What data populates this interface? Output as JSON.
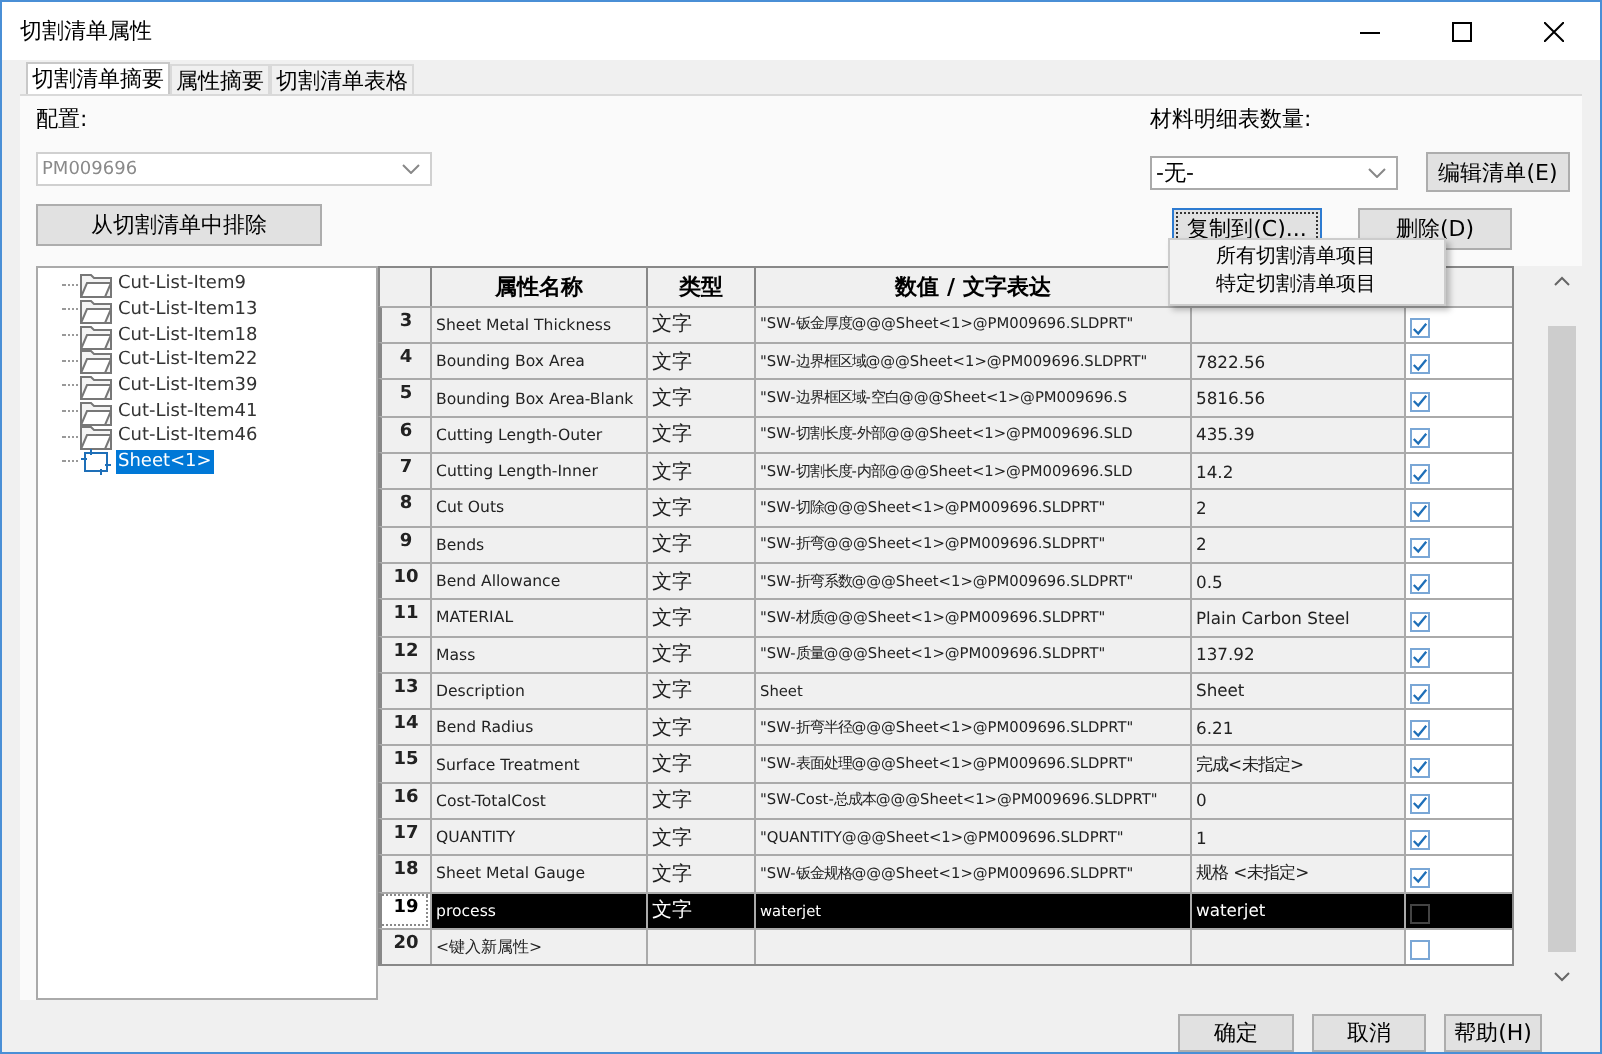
{
  "window": {
    "title": "切割清单属性"
  },
  "tabs": [
    {
      "label": "切割清单摘要",
      "selected": true
    },
    {
      "label": "属性摘要",
      "selected": false
    },
    {
      "label": "切割清单表格",
      "selected": false
    }
  ],
  "config": {
    "label": "配置:",
    "value": "PM009696",
    "disabled": true
  },
  "bom_quantity": {
    "label": "材料明细表数量:",
    "value": "-无-"
  },
  "buttons": {
    "edit_list": "编辑清单(E)",
    "exclude": "从切割清单中排除",
    "copy_to": "复制到(C)...",
    "delete": "删除(D)"
  },
  "copy_menu": [
    "所有切割清单项目",
    "特定切割清单项目"
  ],
  "tree": [
    {
      "label": "Cut-List-Item9",
      "kind": "folder",
      "selected": false
    },
    {
      "label": "Cut-List-Item13",
      "kind": "folder",
      "selected": false
    },
    {
      "label": "Cut-List-Item18",
      "kind": "folder",
      "selected": false
    },
    {
      "label": "Cut-List-Item22",
      "kind": "folder",
      "selected": false
    },
    {
      "label": "Cut-List-Item39",
      "kind": "folder",
      "selected": false
    },
    {
      "label": "Cut-List-Item41",
      "kind": "folder",
      "selected": false
    },
    {
      "label": "Cut-List-Item46",
      "kind": "folder",
      "selected": false
    },
    {
      "label": "Sheet<1>",
      "kind": "sheet",
      "selected": true
    }
  ],
  "table": {
    "columns": [
      "属性名称",
      "类型",
      "数值 / 文字表达"
    ],
    "rows": [
      {
        "num": "3",
        "name": "Sheet Metal Thickness",
        "type": "文字",
        "expr": "\"SW-钣金厚度@@@Sheet<1>@PM009696.SLDPRT\"",
        "checked": true,
        "selected": false
      },
      {
        "num": "4",
        "name": "Bounding Box Area",
        "type": "文字",
        "expr": "\"SW-边界框区域@@@Sheet<1>@PM009696.SLDPRT\"",
        "value": "7822.56",
        "checked": true,
        "selected": false
      },
      {
        "num": "5",
        "name": "Bounding Box Area-Blank",
        "type": "文字",
        "expr": "\"SW-边界框区域-空白@@@Sheet<1>@PM009696.S",
        "value": "5816.56",
        "checked": true,
        "selected": false
      },
      {
        "num": "6",
        "name": "Cutting Length-Outer",
        "type": "文字",
        "expr": "\"SW-切割长度-外部@@@Sheet<1>@PM009696.SLD",
        "value": "435.39",
        "checked": true,
        "selected": false
      },
      {
        "num": "7",
        "name": "Cutting Length-Inner",
        "type": "文字",
        "expr": "\"SW-切割长度-内部@@@Sheet<1>@PM009696.SLD",
        "value": "14.2",
        "checked": true,
        "selected": false
      },
      {
        "num": "8",
        "name": "Cut Outs",
        "type": "文字",
        "expr": "\"SW-切除@@@Sheet<1>@PM009696.SLDPRT\"",
        "value": "2",
        "checked": true,
        "selected": false
      },
      {
        "num": "9",
        "name": "Bends",
        "type": "文字",
        "expr": "\"SW-折弯@@@Sheet<1>@PM009696.SLDPRT\"",
        "value": "2",
        "checked": true,
        "selected": false
      },
      {
        "num": "10",
        "name": "Bend Allowance",
        "type": "文字",
        "expr": "\"SW-折弯系数@@@Sheet<1>@PM009696.SLDPRT\"",
        "value": "0.5",
        "checked": true,
        "selected": false
      },
      {
        "num": "11",
        "name": "MATERIAL",
        "type": "文字",
        "expr": "\"SW-材质@@@Sheet<1>@PM009696.SLDPRT\"",
        "value": "Plain Carbon Steel",
        "checked": true,
        "selected": false
      },
      {
        "num": "12",
        "name": "Mass",
        "type": "文字",
        "expr": "\"SW-质量@@@Sheet<1>@PM009696.SLDPRT\"",
        "value": "137.92",
        "checked": true,
        "selected": false
      },
      {
        "num": "13",
        "name": "Description",
        "type": "文字",
        "expr": "Sheet",
        "value": "Sheet",
        "checked": true,
        "selected": false
      },
      {
        "num": "14",
        "name": "Bend Radius",
        "type": "文字",
        "expr": "\"SW-折弯半径@@@Sheet<1>@PM009696.SLDPRT\"",
        "value": "6.21",
        "checked": true,
        "selected": false
      },
      {
        "num": "15",
        "name": "Surface Treatment",
        "type": "文字",
        "expr": "\"SW-表面处理@@@Sheet<1>@PM009696.SLDPRT\"",
        "value": "完成<未指定>",
        "checked": true,
        "selected": false
      },
      {
        "num": "16",
        "name": "Cost-TotalCost",
        "type": "文字",
        "expr": "\"SW-Cost-总成本@@@Sheet<1>@PM009696.SLDPRT\"",
        "value": "0",
        "checked": true,
        "selected": false
      },
      {
        "num": "17",
        "name": "QUANTITY",
        "type": "文字",
        "expr": "\"QUANTITY@@@Sheet<1>@PM009696.SLDPRT\"",
        "value": "1",
        "checked": true,
        "selected": false
      },
      {
        "num": "18",
        "name": "Sheet Metal Gauge",
        "type": "文字",
        "expr": "\"SW-钣金规格@@@Sheet<1>@PM009696.SLDPRT\"",
        "value": "规格 <未指定>",
        "checked": true,
        "selected": false
      },
      {
        "num": "19",
        "name": "process",
        "type": "文字",
        "expr": "waterjet",
        "value": "waterjet",
        "checked": false,
        "selected": true
      },
      {
        "num": "20",
        "name": "<键入新属性>",
        "checked": false,
        "selected": false
      }
    ]
  },
  "footer_buttons": [
    "确定",
    "取消",
    "帮助(H)"
  ]
}
